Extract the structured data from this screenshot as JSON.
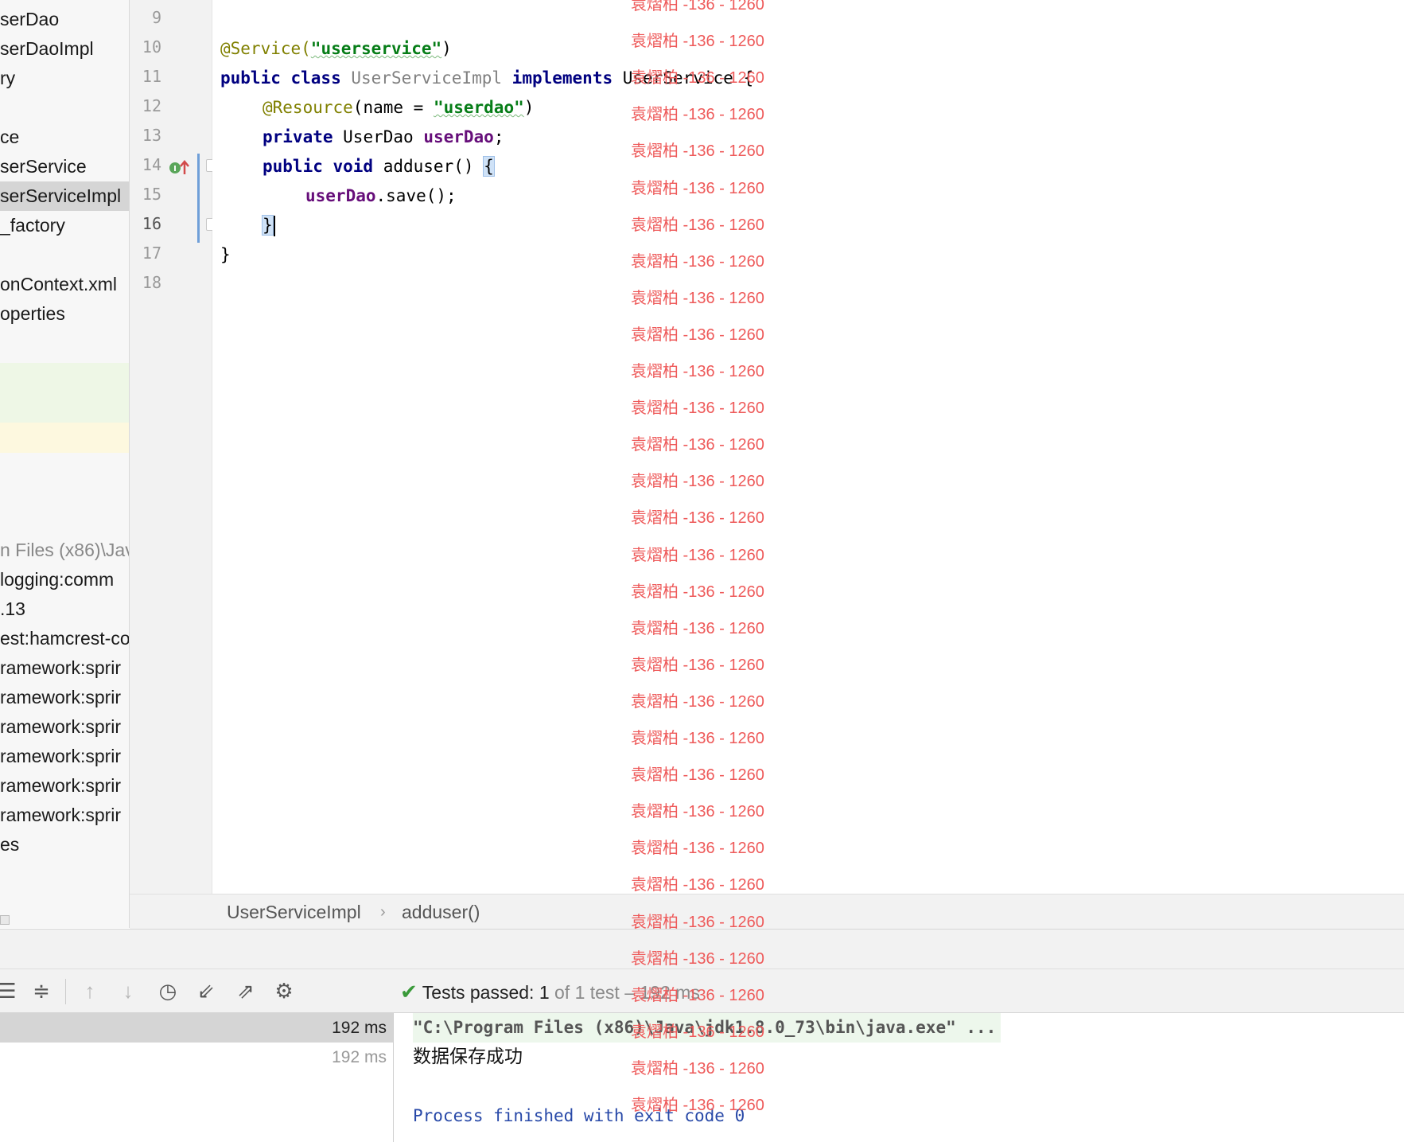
{
  "project_tree": {
    "items": [
      {
        "label": "serDao",
        "selected": false,
        "muted": false
      },
      {
        "label": "serDaoImpl",
        "selected": false,
        "muted": false
      },
      {
        "label": "ry",
        "selected": false,
        "muted": false
      },
      {
        "label": "",
        "selected": false,
        "muted": false
      },
      {
        "label": "ce",
        "selected": false,
        "muted": false
      },
      {
        "label": "serService",
        "selected": false,
        "muted": false
      },
      {
        "label": "serServiceImpl",
        "selected": true,
        "muted": false
      },
      {
        "label": "_factory",
        "selected": false,
        "muted": false
      },
      {
        "label": "",
        "selected": false,
        "muted": false
      },
      {
        "label": "onContext.xml",
        "selected": false,
        "muted": false
      },
      {
        "label": "operties",
        "selected": false,
        "muted": false
      }
    ],
    "libraries": [
      {
        "label": "n Files (x86)\\Jav",
        "muted": true
      },
      {
        "label": "logging:comm",
        "muted": false
      },
      {
        "label": ".13",
        "muted": false
      },
      {
        "label": "est:hamcrest-co",
        "muted": false
      },
      {
        "label": "ramework:sprir",
        "muted": false
      },
      {
        "label": "ramework:sprir",
        "muted": false
      },
      {
        "label": "ramework:sprir",
        "muted": false
      },
      {
        "label": "ramework:sprir",
        "muted": false
      },
      {
        "label": "ramework:sprir",
        "muted": false
      },
      {
        "label": "ramework:sprir",
        "muted": false
      },
      {
        "label": "es",
        "muted": false
      }
    ]
  },
  "editor": {
    "line_numbers": [
      "9",
      "10",
      "11",
      "12",
      "13",
      "14",
      "15",
      "16",
      "17",
      "18"
    ],
    "current_line": "16",
    "code": {
      "l10_ann": "@Service(",
      "l10_str": "\"userservice\"",
      "l10_end": ")",
      "l11_kw1": "public class ",
      "l11_cls": "UserServiceImpl ",
      "l11_kw2": "implements ",
      "l11_iface": "UserService {",
      "l12_ann": "@Resource",
      "l12_mid": "(name = ",
      "l12_str": "\"userdao\"",
      "l12_end": ")",
      "l13_kw": "private ",
      "l13_type": "UserDao ",
      "l13_field": "userDao",
      "l13_end": ";",
      "l14_kw": "public void ",
      "l14_name": "adduser() ",
      "l14_brace": "{",
      "l15_field": "userDao",
      "l15_end": ".save();",
      "l16_brace": "}",
      "l17_brace": "}"
    }
  },
  "watermark": {
    "text": "袁熠柏 -136 - 1260",
    "color": "#ee5a5a"
  },
  "breadcrumb": {
    "class_name": "UserServiceImpl",
    "separator": "›",
    "method_name": "adduser()"
  },
  "run_toolbar": {
    "icons": [
      "expand-all-icon",
      "collapse-all-icon",
      "arrow-up-icon",
      "arrow-down-icon",
      "history-icon",
      "import-icon",
      "export-icon",
      "gear-icon"
    ],
    "status_passed": "Tests passed: 1",
    "status_of": " of 1 test",
    "status_time": " – 192 ms"
  },
  "test_tree": {
    "rows": [
      {
        "duration": "192 ms",
        "selected": true
      },
      {
        "duration": "192 ms",
        "selected": false
      }
    ]
  },
  "console": {
    "command": "\"C:\\Program Files (x86)\\Java\\jdk1.8.0_73\\bin\\java.exe\" ...",
    "output": "数据保存成功",
    "exit": "Process finished with exit code 0"
  },
  "colors": {
    "keyword": "#000080",
    "annotation": "#808000",
    "string": "#067d17",
    "field": "#660e7a",
    "success": "#3a9a3a"
  }
}
